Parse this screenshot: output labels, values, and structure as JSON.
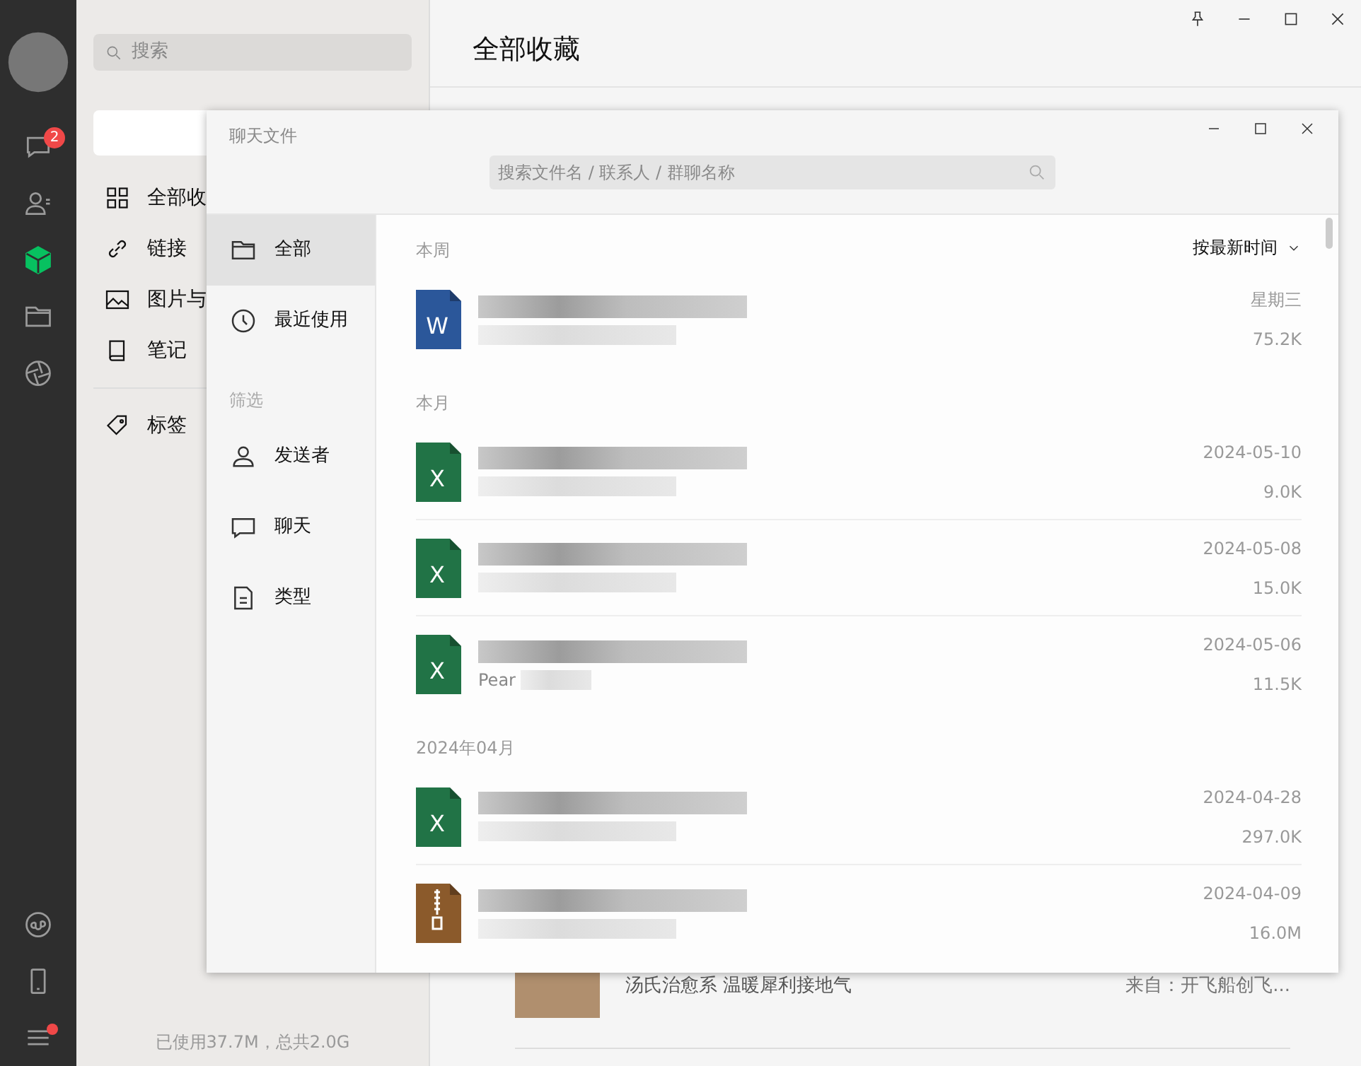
{
  "rail": [
    {
      "kind": "avatar"
    },
    {
      "kind": "chat",
      "selected": false,
      "badge": "2"
    },
    {
      "kind": "contacts",
      "selected": false
    },
    {
      "kind": "favorites",
      "selected": true
    },
    {
      "kind": "folder",
      "selected": false
    },
    {
      "kind": "moments",
      "selected": false
    },
    {
      "kind": "miniprogram",
      "selected": false
    },
    {
      "kind": "phone",
      "selected": false
    },
    {
      "kind": "menu",
      "selected": false,
      "dot": true
    }
  ],
  "left_panel": {
    "search": {
      "placeholder": "搜索"
    },
    "nav": [
      {
        "kind": "grid",
        "label": "全部收"
      },
      {
        "kind": "link",
        "label": "链接"
      },
      {
        "kind": "image",
        "label": "图片与"
      },
      {
        "kind": "book",
        "label": "笔记"
      }
    ],
    "tags": {
      "label": "标签"
    },
    "storage": "已使用37.7M，总共2.0G"
  },
  "main": {
    "title": "全部收藏",
    "item": {
      "title": "汤氏治愈系 温暖犀利接地气",
      "source": "来自：开飞船创飞..."
    }
  },
  "dialog": {
    "title": "聊天文件",
    "search": {
      "placeholder": "搜索文件名 / 联系人 / 群聊名称"
    },
    "sidebar": [
      {
        "kind": "folder",
        "label": "全部",
        "selected": true
      },
      {
        "kind": "clock",
        "label": "最近使用",
        "selected": false
      }
    ],
    "filter_heading": "筛选",
    "filters": [
      {
        "kind": "person",
        "label": "发送者"
      },
      {
        "kind": "chat",
        "label": "聊天"
      },
      {
        "kind": "doc",
        "label": "类型"
      }
    ],
    "sort": "按最新时间",
    "groups": [
      {
        "heading": "本周",
        "files": [
          {
            "kind": "word",
            "icon_letter": "W",
            "date": "星期三",
            "size": "75.2K"
          }
        ]
      },
      {
        "heading": "本月",
        "files": [
          {
            "kind": "excel",
            "icon_letter": "X",
            "date": "2024-05-10",
            "size": "9.0K"
          },
          {
            "kind": "excel",
            "icon_letter": "X",
            "date": "2024-05-08",
            "size": "15.0K"
          },
          {
            "kind": "excel",
            "icon_letter": "X",
            "date": "2024-05-06",
            "size": "11.5K",
            "sender": "Pear"
          }
        ]
      },
      {
        "heading": "2024年04月",
        "files": [
          {
            "kind": "excel",
            "icon_letter": "X",
            "date": "2024-04-28",
            "size": "297.0K"
          },
          {
            "kind": "zip",
            "date": "2024-04-09",
            "size": "16.0M"
          }
        ]
      }
    ]
  }
}
